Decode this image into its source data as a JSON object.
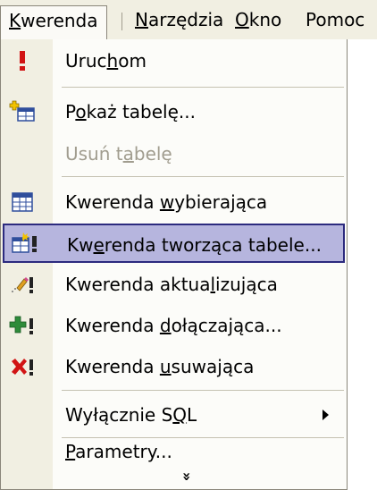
{
  "menubar": {
    "items": [
      {
        "label": "Kwerenda",
        "ul": "K",
        "rest": "werenda"
      },
      {
        "label": "Narzędzia",
        "ul": "N",
        "rest": "arzędzia"
      },
      {
        "label": "Okno",
        "ul": "O",
        "rest": "kno"
      },
      {
        "label": "Pomoc",
        "ul": "",
        "rest": "Pomoc"
      }
    ]
  },
  "menu": {
    "items": [
      {
        "pre": "Uruc",
        "ul": "h",
        "post": "om",
        "icon": "run-exclamation-icon",
        "enabled": true
      },
      {
        "pre": "P",
        "ul": "o",
        "post": "każ tabelę...",
        "icon": "show-table-icon",
        "enabled": true
      },
      {
        "pre": "Usuń t",
        "ul": "a",
        "post": "belę",
        "icon": "",
        "enabled": false
      },
      {
        "pre": "Kwerenda ",
        "ul": "w",
        "post": "ybierająca",
        "icon": "select-query-icon",
        "enabled": true
      },
      {
        "pre": "Kw",
        "ul": "e",
        "post": "renda tworząca tabele...",
        "icon": "make-table-query-icon",
        "enabled": true,
        "highlighted": true
      },
      {
        "pre": "Kwerenda aktua",
        "ul": "l",
        "post": "izująca",
        "icon": "update-query-icon",
        "enabled": true
      },
      {
        "pre": "Kwerenda ",
        "ul": "d",
        "post": "ołączająca...",
        "icon": "append-query-icon",
        "enabled": true
      },
      {
        "pre": "Kwerenda ",
        "ul": "u",
        "post": "suwająca",
        "icon": "delete-query-icon",
        "enabled": true
      },
      {
        "pre": "Wyłącznie S",
        "ul": "Q",
        "post": "L",
        "icon": "",
        "enabled": true,
        "submenu": true
      },
      {
        "pre": "",
        "ul": "P",
        "post": "arametry...",
        "icon": "",
        "enabled": true
      }
    ],
    "expand_glyph": "»"
  },
  "colors": {
    "highlight_bg": "#b6b5de",
    "highlight_border": "#2c2a7e",
    "gutter": "#f1efe2",
    "disabled_text": "#a19d8f"
  }
}
